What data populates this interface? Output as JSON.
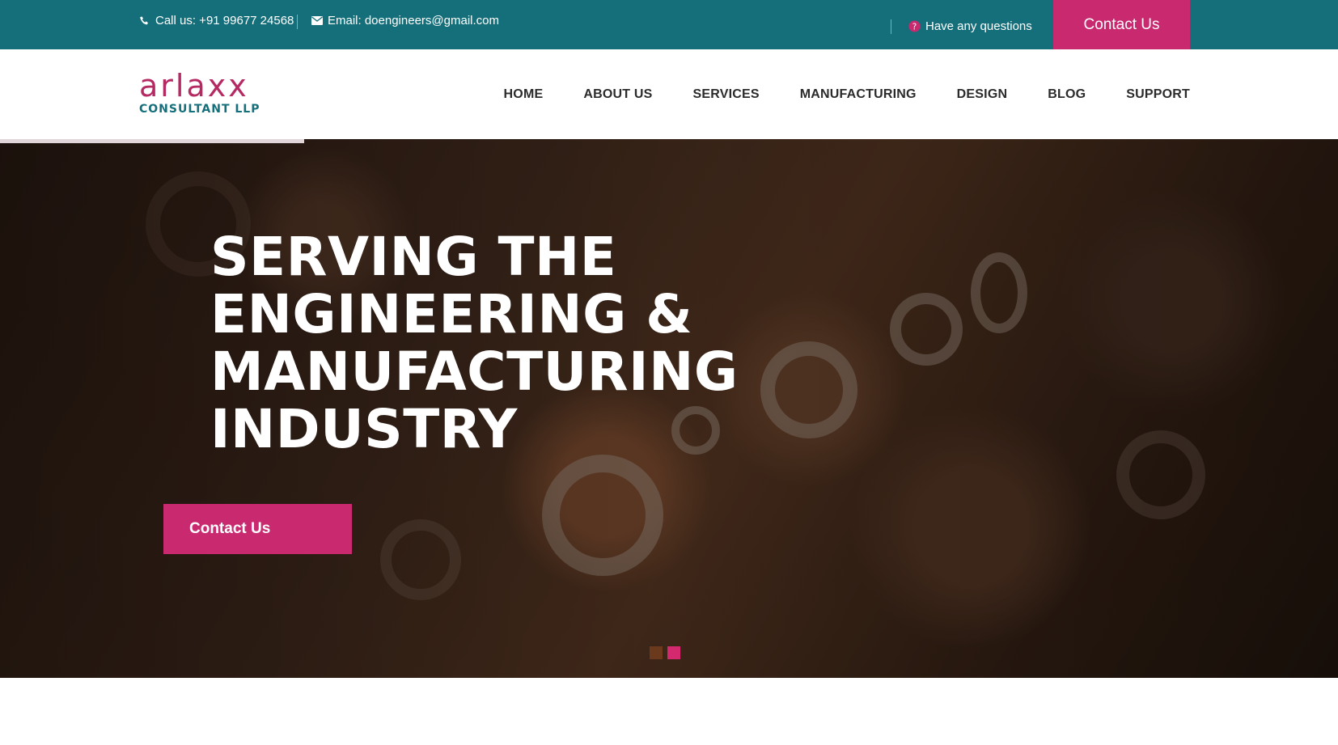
{
  "topbar": {
    "phone_text": "Call us: +91 99677 24568",
    "email_text": "Email: doengineers@gmail.com",
    "question_text": "Have any questions",
    "contact_label": "Contact Us",
    "bg_color": "#156f7a",
    "accent_color": "#c92a6f"
  },
  "logo": {
    "name": "arlaxx",
    "sub": "CONSULTANT  LLP"
  },
  "nav": {
    "items": [
      "HOME",
      "ABOUT US",
      "SERVICES",
      "MANUFACTURING",
      "DESIGN",
      "BLOG",
      "SUPPORT"
    ]
  },
  "hero": {
    "title_lines": [
      "SERVING THE",
      "ENGINEERING &",
      "MANUFACTURING",
      "INDUSTRY"
    ],
    "button_label": "Contact Us",
    "slides_total": 2,
    "slide_active": 2
  },
  "icons": [
    "phone-icon",
    "mail-icon",
    "question-icon"
  ]
}
